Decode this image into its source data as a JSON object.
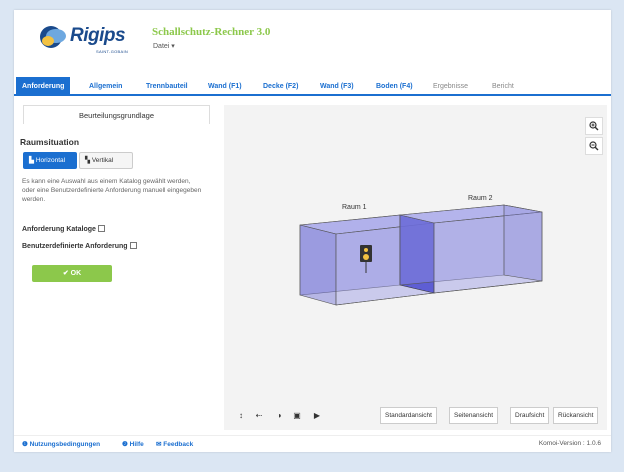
{
  "header": {
    "logo_text": "Rigips",
    "logo_sub": "SAINT-GOBAIN",
    "app_title": "Schallschutz-Rechner 3.0",
    "file_menu": "Datei ▾"
  },
  "tabs": [
    {
      "label": "Anforderung"
    },
    {
      "label": "Allgemein"
    },
    {
      "label": "Trennbauteil"
    },
    {
      "label": "Wand (F1)"
    },
    {
      "label": "Decke (F2)"
    },
    {
      "label": "Wand (F3)"
    },
    {
      "label": "Boden (F4)"
    },
    {
      "label": "Ergebnisse"
    },
    {
      "label": "Bericht"
    }
  ],
  "left": {
    "panel_tab": "Beurteilungsgrundlage",
    "section_title": "Raumsituation",
    "btn_horizontal": "Horizontal",
    "btn_vertical": "Vertikal",
    "description": "Es kann eine Auswahl aus einem Katalog gewählt werden, oder eine Benutzerdefinierte Anforderung manuell eingegeben werden.",
    "chk_katalog": "Anforderung Kataloge",
    "chk_benutzer": "Benutzerdefinierte Anforderung",
    "ok": "OK"
  },
  "viewer": {
    "room1": "Raum 1",
    "room2": "Raum 2",
    "zoom_in": "+",
    "zoom_out": "−",
    "views": [
      "Standardansicht",
      "Seitenansicht",
      "Draufsicht",
      "Rückansicht"
    ],
    "icons": [
      "arrows-vertical-icon",
      "arrow-left-icon",
      "contrast-icon",
      "camera-icon",
      "play-icon"
    ]
  },
  "footer": {
    "terms": "Nutzungsbedingungen",
    "help": "Hilfe",
    "feedback": "Feedback",
    "version": "Komoi-Version : 1.0.6"
  },
  "colors": {
    "primary": "#1b6fd0",
    "accent_green": "#8cc84b",
    "room_fill": "#8f8fe0",
    "room_fill_dark": "#5a5ad6",
    "background": "#dbe6f3"
  }
}
